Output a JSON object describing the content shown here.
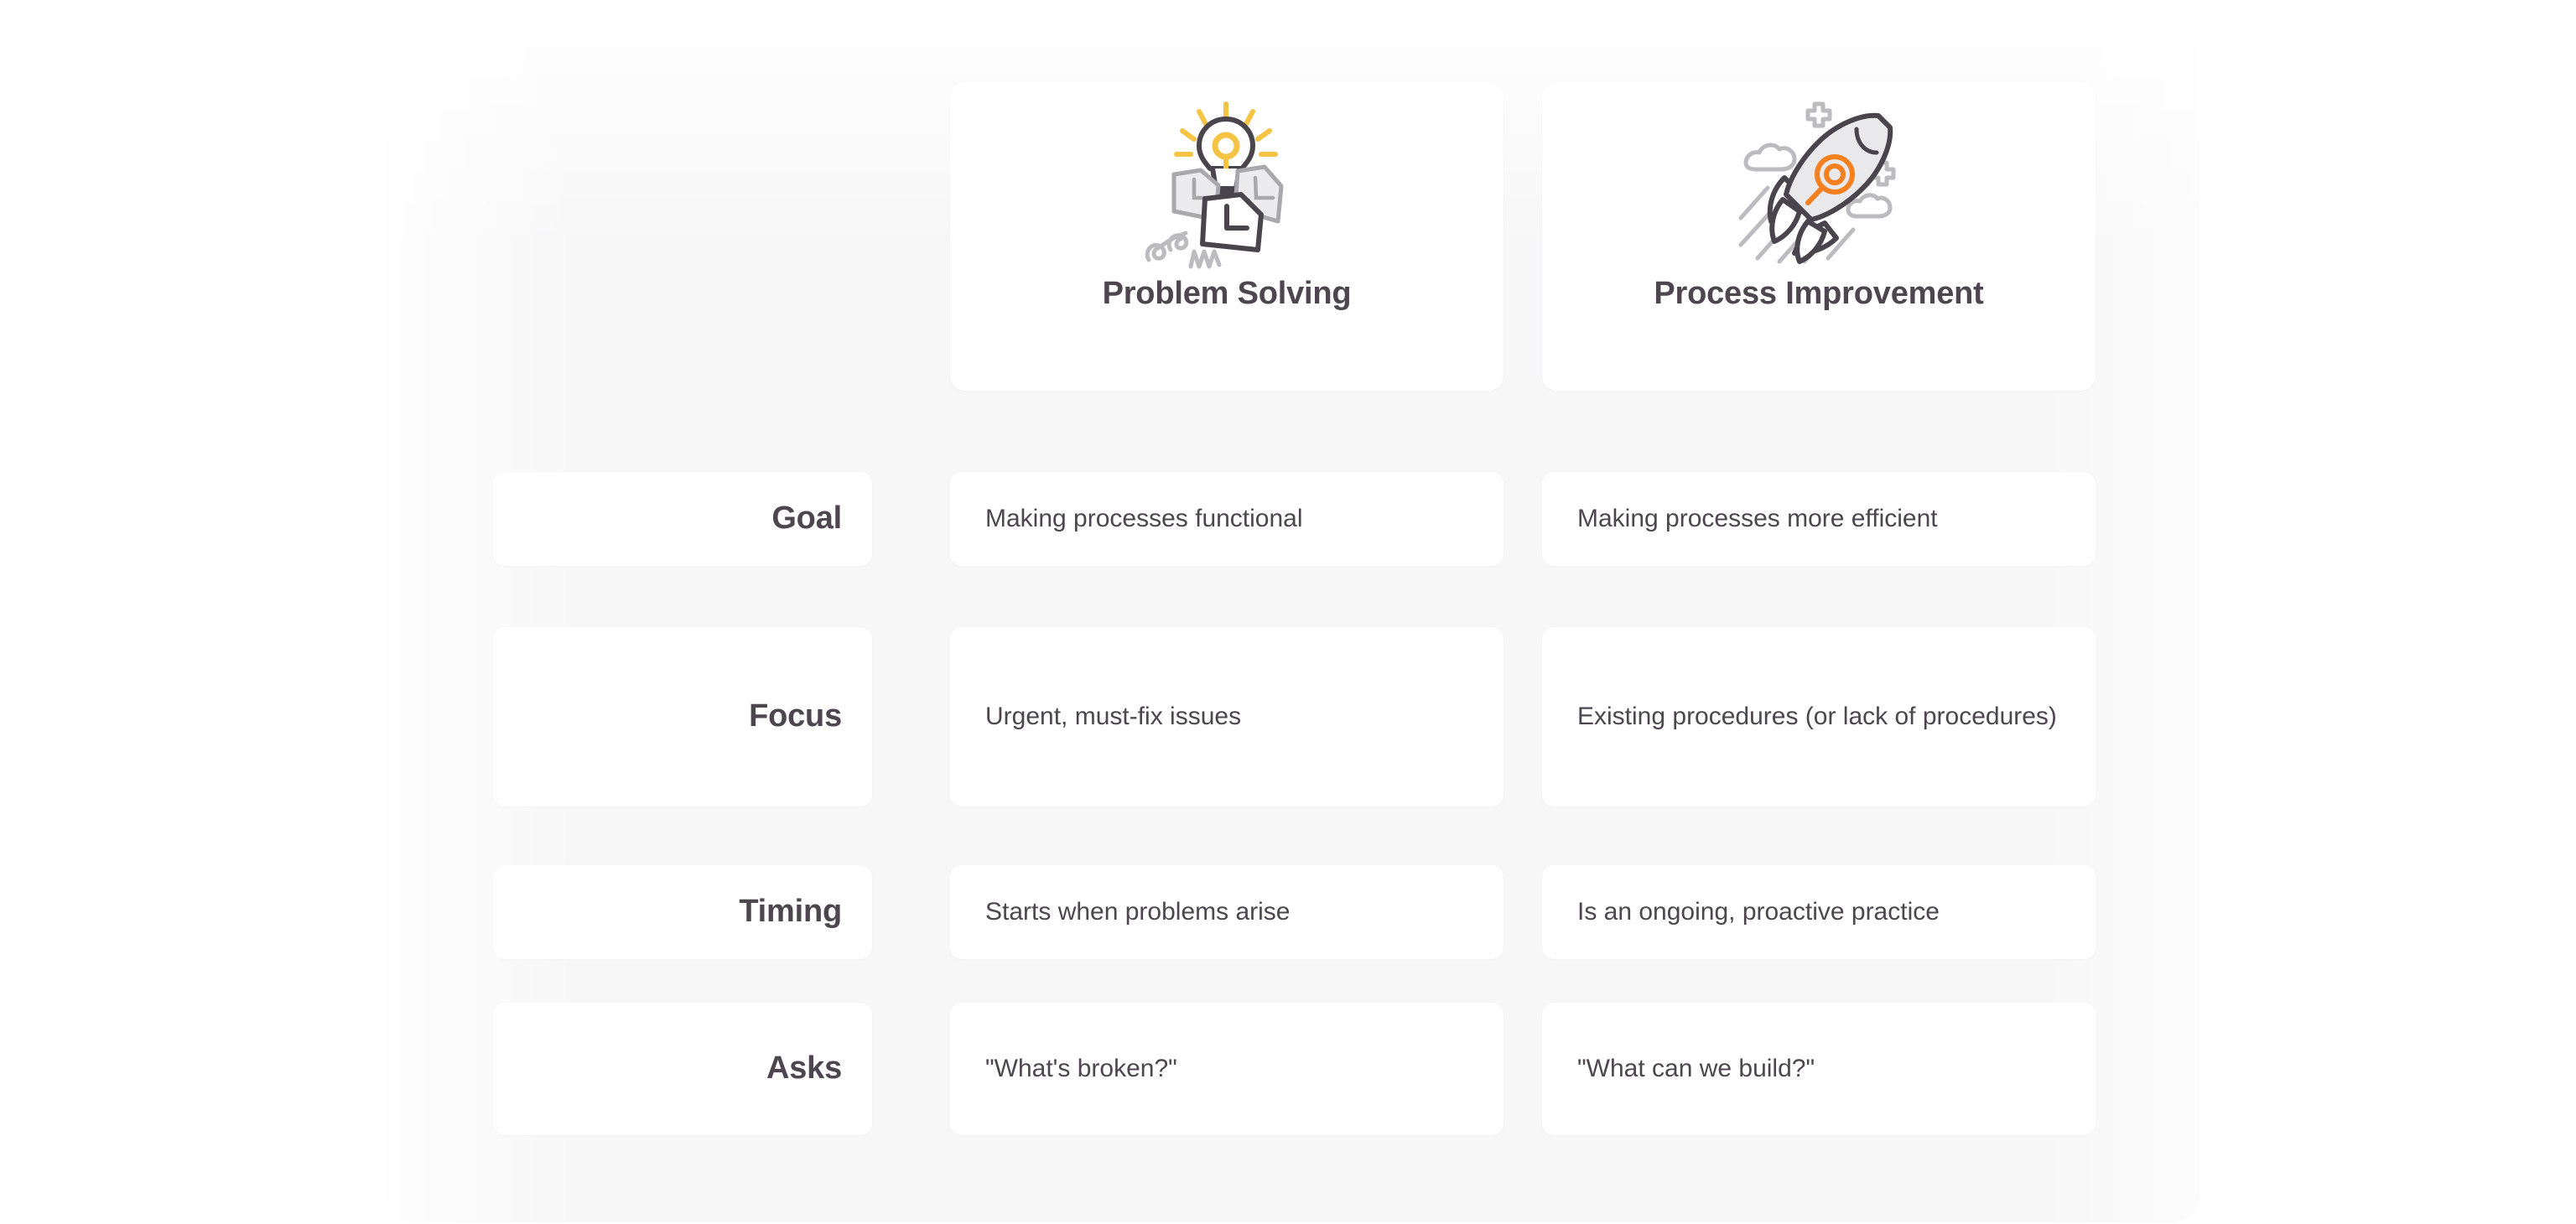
{
  "columns": [
    {
      "id": "problem-solving",
      "title": "Problem Solving",
      "icon": "lightbulb-documents-icon"
    },
    {
      "id": "process-improvement",
      "title": "Process Improvement",
      "icon": "rocket-icon"
    }
  ],
  "rows": [
    {
      "label": "Goal",
      "cells": [
        "Making processes functional",
        "Making processes more efficient"
      ]
    },
    {
      "label": "Focus",
      "cells": [
        "Urgent, must-fix issues",
        "Existing procedures (or lack of procedures)"
      ]
    },
    {
      "label": "Timing",
      "cells": [
        "Starts when problems arise",
        "Is an ongoing, proactive practice"
      ]
    },
    {
      "label": "Asks",
      "cells": [
        "\"What's broken?\"",
        "\"What can we build?\""
      ]
    }
  ],
  "colors": {
    "text": "#4d464f",
    "card": "#ffffff",
    "panel": "#f7f7f8",
    "page": "#ffffff",
    "icon_gray": "#a8a8ad",
    "icon_dark": "#4a444c",
    "icon_yellow": "#f5c444",
    "icon_orange": "#f4801f"
  }
}
